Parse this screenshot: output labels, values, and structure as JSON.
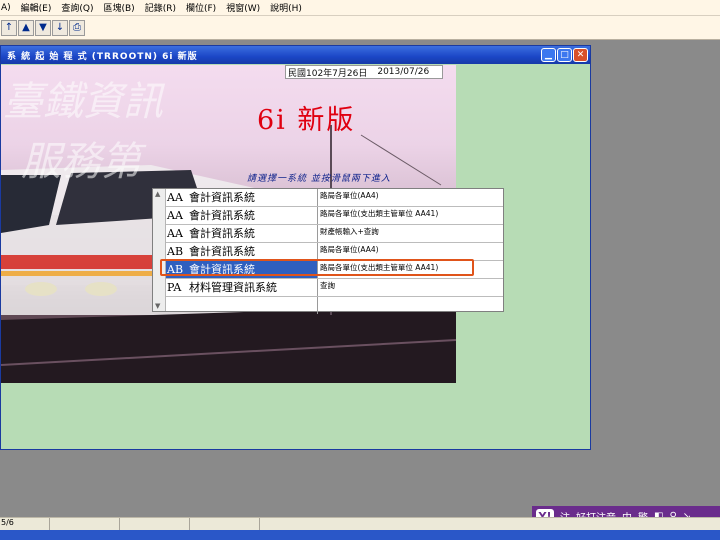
{
  "menubar": {
    "items": [
      "A)",
      "編輯(E)",
      "查詢(Q)",
      "區塊(B)",
      "記錄(R)",
      "欄位(F)",
      "視窗(W)",
      "說明(H)"
    ]
  },
  "toolbar": {
    "buttons": [
      {
        "name": "up-arrow-icon",
        "glyph": "↑"
      },
      {
        "name": "triangle-up-icon",
        "glyph": "▲"
      },
      {
        "name": "triangle-down-icon",
        "glyph": "▼"
      },
      {
        "name": "down-arrow-icon",
        "glyph": "↓"
      },
      {
        "name": "printer-icon",
        "glyph": "⎙"
      }
    ]
  },
  "window": {
    "title": "系 統 起 始 程 式 (TRROOTN) 6i 新版",
    "buttons": {
      "minimize": "▁",
      "maximize": "□",
      "close": "✕"
    }
  },
  "banner": {
    "watermark_line1": "臺鐵資訊",
    "watermark_line2": "服務第",
    "date_roc": "民國102年7月26日",
    "date_iso": "2013/07/26",
    "version_title": "6i 新版",
    "prompt": "請選擇一系統 並按滑鼠兩下進入"
  },
  "systems": [
    {
      "code": "AA",
      "name": "會計資訊系統",
      "detail": "路局各單位(AA4)"
    },
    {
      "code": "AA",
      "name": "會計資訊系統",
      "detail": "路局各單位(支出類主管單位 AA41)"
    },
    {
      "code": "AA",
      "name": "會計資訊系統",
      "detail": "財產帳輸入+查詢"
    },
    {
      "code": "AB",
      "name": "會計資訊系統",
      "detail": "路局各單位(AA4)"
    },
    {
      "code": "AB",
      "name": "會計資訊系統",
      "detail": "路局各單位(支出類主管單位 AA41)"
    },
    {
      "code": "PA",
      "name": "材料管理資訊系統",
      "detail": "查詢"
    },
    {
      "code": "",
      "name": "",
      "detail": ""
    }
  ],
  "selected_index": 4,
  "statusbar": {
    "record": "5/6"
  },
  "ime": {
    "logo": "Y!",
    "items": [
      "注",
      "好打注音",
      "中",
      "繁",
      "◧",
      "♀",
      "↘"
    ]
  }
}
